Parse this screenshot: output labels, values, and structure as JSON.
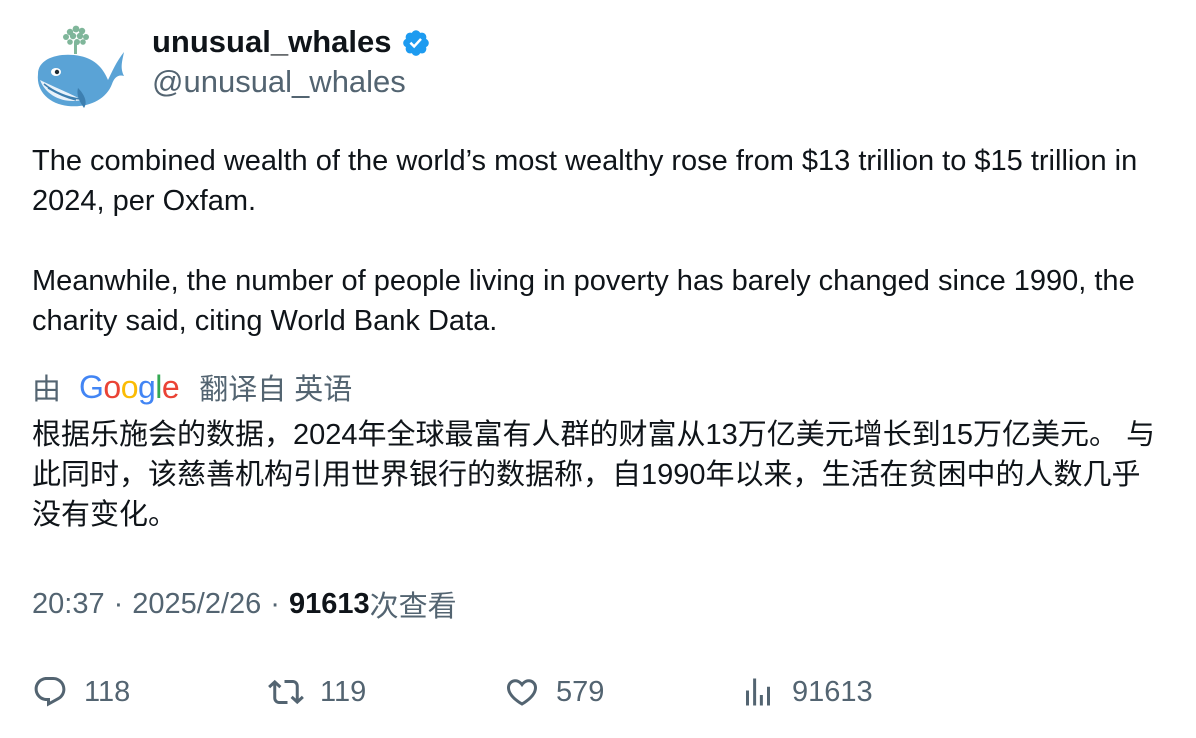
{
  "author": {
    "display_name": "unusual_whales",
    "handle": "@unusual_whales",
    "verified": true,
    "avatar_icon": "whale-icon",
    "verified_color": "#1d9bf0"
  },
  "tweet": {
    "paragraphs": [
      "The combined wealth of the world’s most wealthy rose from $13 trillion to $15 trillion in 2024, per Oxfam.",
      "Meanwhile, the number of people living in poverty has barely changed since 1990, the charity said, citing World Bank Data."
    ]
  },
  "translation": {
    "by_label": "由",
    "provider": "Google",
    "from_label": "翻译自 英语",
    "text": "根据乐施会的数据，2024年全球最富有人群的财富从13万亿美元增长到15万亿美元。 与此同时，该慈善机构引用世界银行的数据称，自1990年以来，生活在贫困中的人数几乎没有变化。"
  },
  "meta": {
    "time": "20:37",
    "separator": "·",
    "date": "2025/2/26",
    "views_count": "91613",
    "views_label": "次查看"
  },
  "actions": {
    "replies": "118",
    "retweets": "119",
    "likes": "579",
    "views": "91613"
  },
  "colors": {
    "text_primary": "#0f1419",
    "text_secondary": "#536471",
    "verified_blue": "#1d9bf0"
  }
}
